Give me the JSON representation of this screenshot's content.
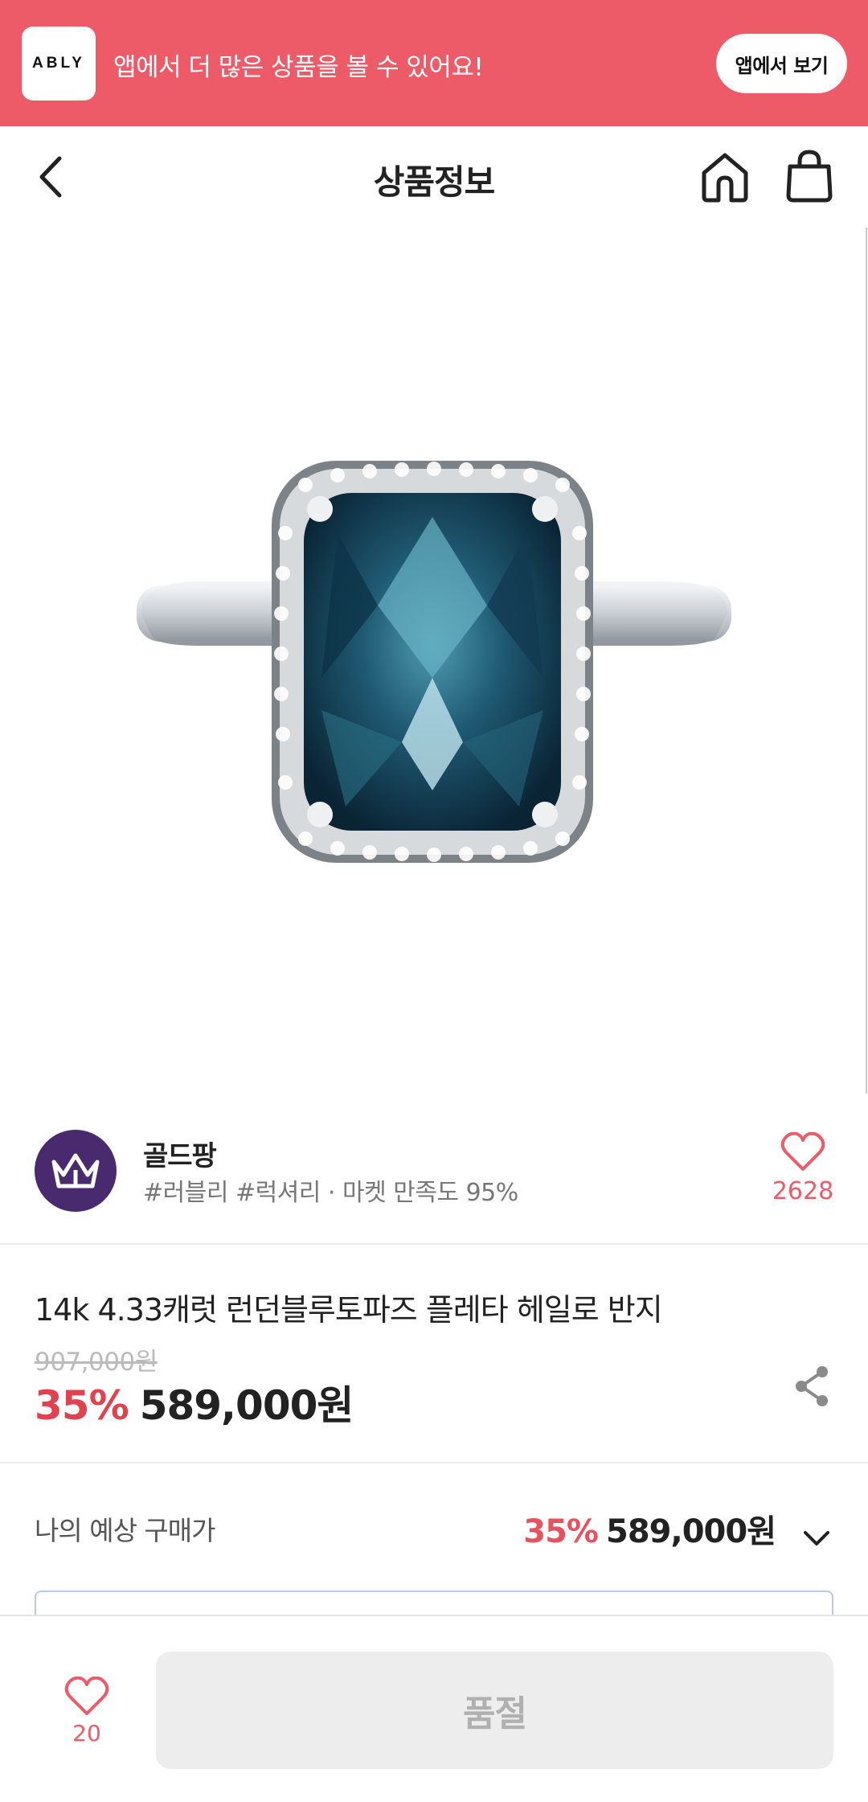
{
  "banner": {
    "logo_text": "ABLY",
    "message": "앱에서 더 많은 상품을 볼 수 있어요!",
    "open_app_label": "앱에서 보기"
  },
  "header": {
    "title": "상품정보",
    "back_icon": "chevron-left-icon",
    "home_icon": "home-icon",
    "cart_icon": "shopping-bag-icon"
  },
  "product_image": {
    "subject": "blue-topaz-halo-ring"
  },
  "seller": {
    "name": "골드팡",
    "tags": "#러블리 #럭셔리 · 마켓 만족도 95%",
    "like_count": "2628",
    "avatar_icon": "crown-icon"
  },
  "product": {
    "name": "14k 4.33캐럿 런던블루토파즈 플레타 헤일로 반지",
    "original_price": "907,000원",
    "discount": "35%",
    "price": "589,000원",
    "share_icon": "share-icon"
  },
  "expected_price": {
    "label": "나의 예상 구매가",
    "discount": "35%",
    "price": "589,000원"
  },
  "bottom_bar": {
    "wish_count": "20",
    "soldout_label": "품절"
  },
  "colors": {
    "brand": "#ee5b68",
    "discount": "#e0424f"
  }
}
